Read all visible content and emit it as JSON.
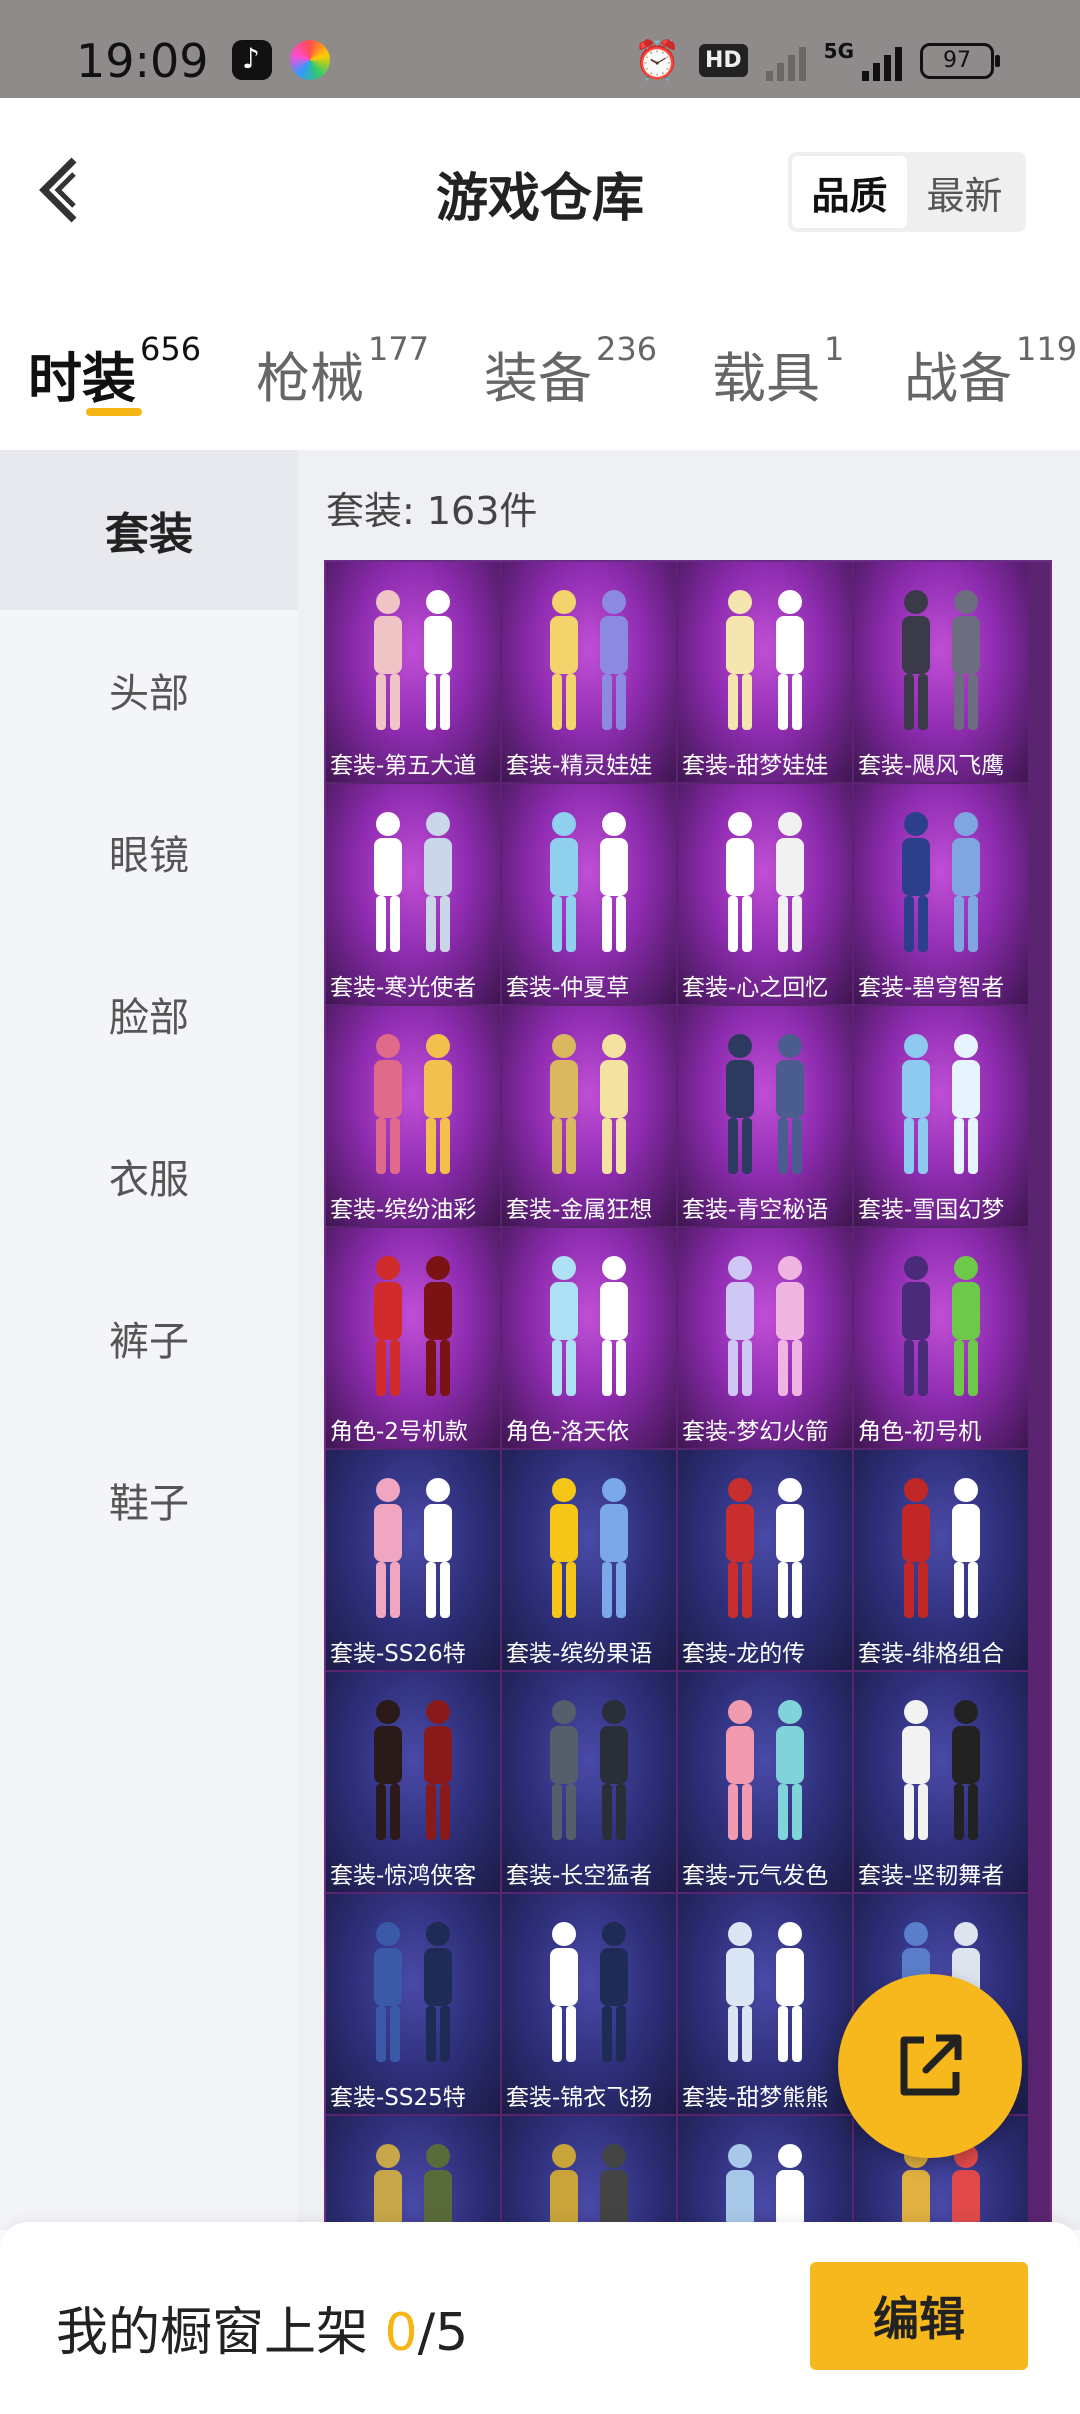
{
  "status_bar": {
    "time": "19:09",
    "icons": [
      "tiktok-icon",
      "color-app-icon",
      "alarm-icon",
      "hd-icon",
      "signal-icon",
      "5g-signal-icon",
      "battery-icon"
    ],
    "hd": "HD",
    "network": "5G",
    "battery": "97"
  },
  "header": {
    "title": "游戏仓库",
    "sort_options": [
      "品质",
      "最新"
    ],
    "sort_selected": "品质"
  },
  "tabs": [
    {
      "label": "时装",
      "count": "656",
      "active": true
    },
    {
      "label": "枪械",
      "count": "177",
      "active": false
    },
    {
      "label": "装备",
      "count": "236",
      "active": false
    },
    {
      "label": "载具",
      "count": "1",
      "active": false
    },
    {
      "label": "战备",
      "count": "119",
      "active": false
    }
  ],
  "sidebar": {
    "items": [
      "套装",
      "头部",
      "眼镜",
      "脸部",
      "衣服",
      "裤子",
      "鞋子"
    ],
    "selected": "套装"
  },
  "main": {
    "count_label": "套装: 163件",
    "items": [
      {
        "name": "套装-第五大道",
        "tier": "purple"
      },
      {
        "name": "套装-精灵娃娃",
        "tier": "purple"
      },
      {
        "name": "套装-甜梦娃娃",
        "tier": "purple"
      },
      {
        "name": "套装-飓风飞鹰",
        "tier": "purple"
      },
      {
        "name": "套装-寒光使者",
        "tier": "purple"
      },
      {
        "name": "套装-仲夏草",
        "tier": "purple"
      },
      {
        "name": "套装-心之回忆",
        "tier": "purple"
      },
      {
        "name": "套装-碧穹智者",
        "tier": "purple"
      },
      {
        "name": "套装-缤纷油彩",
        "tier": "purple"
      },
      {
        "name": "套装-金属狂想",
        "tier": "purple"
      },
      {
        "name": "套装-青空秘语",
        "tier": "purple"
      },
      {
        "name": "套装-雪国幻梦",
        "tier": "purple"
      },
      {
        "name": "角色-2号机款",
        "tier": "purple"
      },
      {
        "name": "角色-洛天依",
        "tier": "purple"
      },
      {
        "name": "套装-梦幻火箭",
        "tier": "purple"
      },
      {
        "name": "角色-初号机",
        "tier": "purple"
      },
      {
        "name": "套装-SS26特",
        "tier": "blue"
      },
      {
        "name": "套装-缤纷果语",
        "tier": "blue"
      },
      {
        "name": "套装-龙的传",
        "tier": "blue"
      },
      {
        "name": "套装-绯格组合",
        "tier": "blue"
      },
      {
        "name": "套装-惊鸿侠客",
        "tier": "blue"
      },
      {
        "name": "套装-长空猛者",
        "tier": "blue"
      },
      {
        "name": "套装-元气发色",
        "tier": "blue"
      },
      {
        "name": "套装-坚韧舞者",
        "tier": "blue"
      },
      {
        "name": "套装-SS25特",
        "tier": "blue"
      },
      {
        "name": "套装-锦衣飞扬",
        "tier": "blue"
      },
      {
        "name": "套装-甜梦熊熊",
        "tier": "blue"
      },
      {
        "name": "套装-",
        "tier": "blue"
      },
      {
        "name": "",
        "tier": "blue"
      },
      {
        "name": "",
        "tier": "blue"
      },
      {
        "name": "",
        "tier": "blue"
      },
      {
        "name": "",
        "tier": "blue"
      }
    ]
  },
  "bottom_bar": {
    "label": "我的橱窗上架 ",
    "current": "0",
    "total": "/5",
    "edit_label": "编辑"
  },
  "colors": {
    "accent": "#f7b81e",
    "purple_tier": "#9b34bf",
    "blue_tier": "#2e2f7a"
  }
}
